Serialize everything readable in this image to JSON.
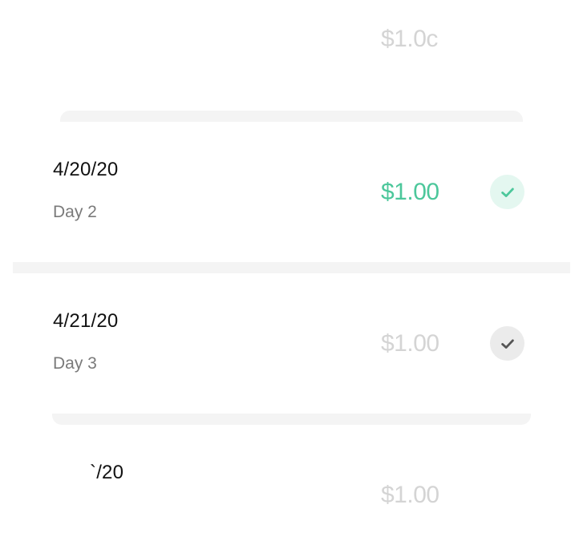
{
  "rows": [
    {
      "date": "",
      "day": "",
      "amount": "$1.0с",
      "status": "unpaid"
    },
    {
      "date": "4/20/20",
      "day": "Day 2",
      "amount": "$1.00",
      "status": "paid"
    },
    {
      "date": "4/21/20",
      "day": "Day 3",
      "amount": "$1.00",
      "status": "checked"
    },
    {
      "date": "`/20",
      "day": "",
      "amount": "$1.00",
      "status": "unpaid"
    }
  ],
  "colors": {
    "paid_accent": "#4cc79b",
    "paid_check_bg": "#e4f7f0",
    "unpaid_amount": "#d4d4d4",
    "unpaid_check_bg": "#ebebeb",
    "unpaid_check_icon": "#555555",
    "separator": "#f4f4f4"
  },
  "icons": {
    "check": "check-icon"
  }
}
